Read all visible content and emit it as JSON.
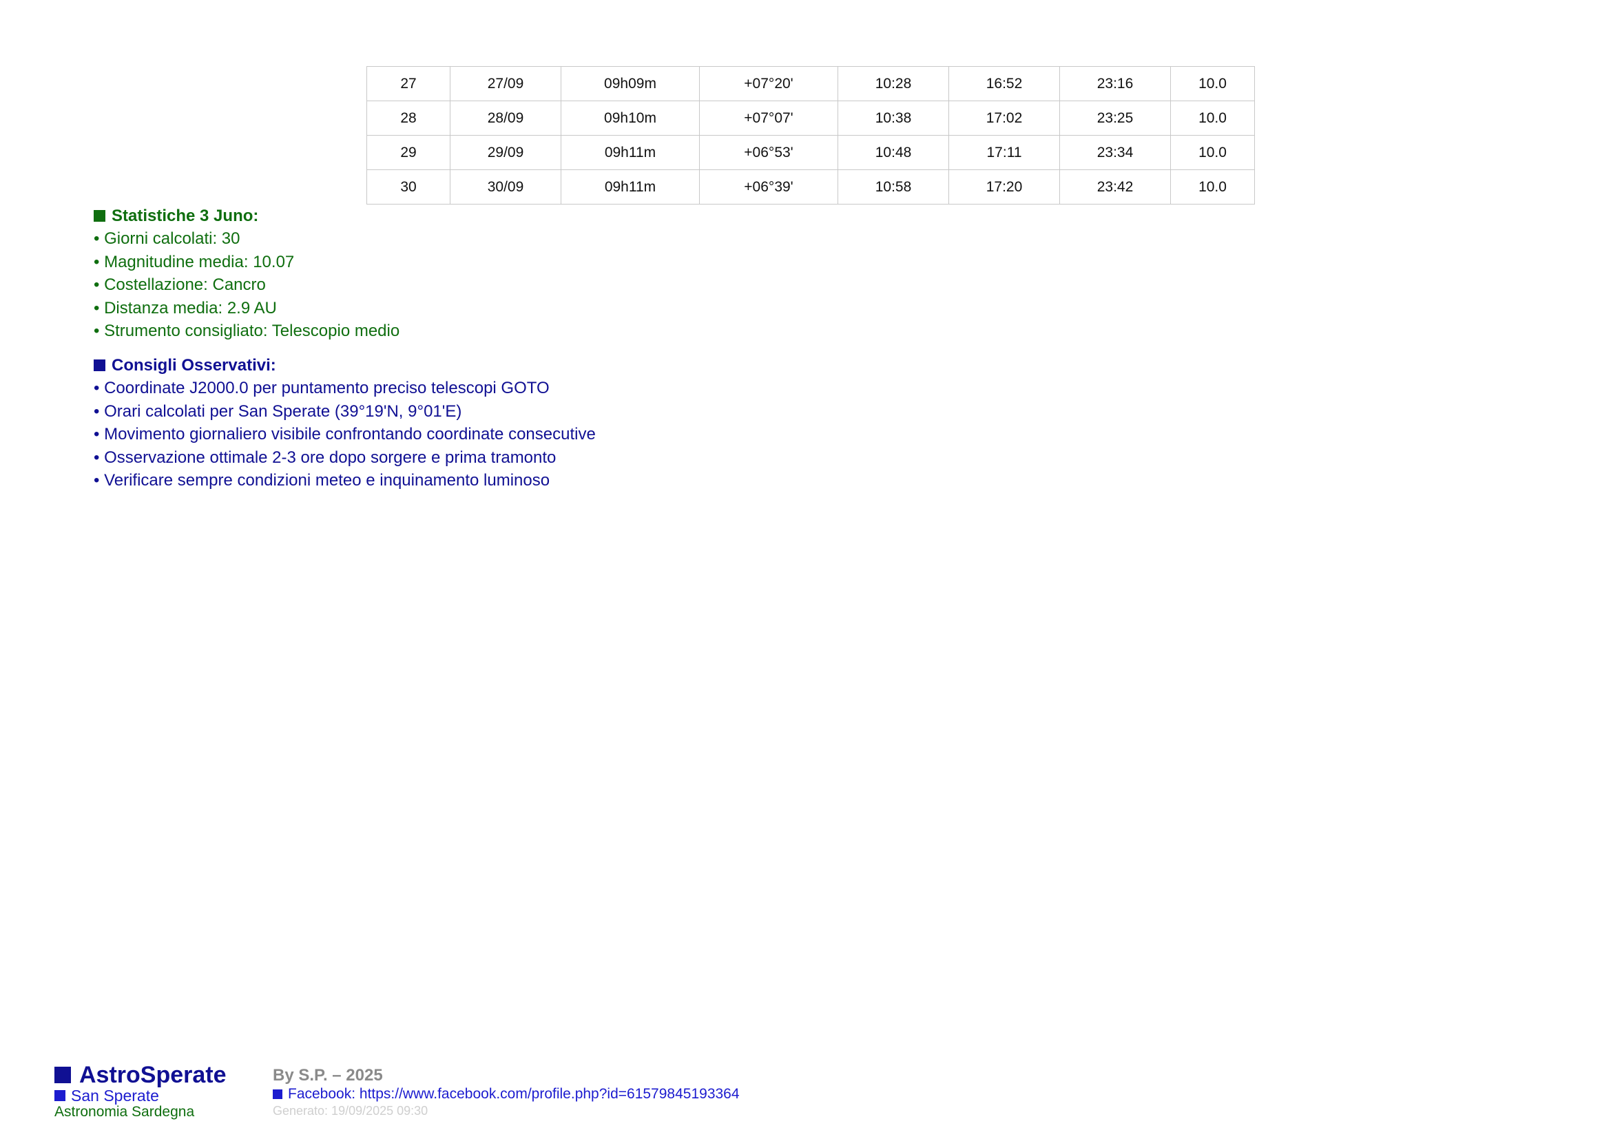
{
  "ephemeris_table": {
    "rows": [
      [
        "27",
        "27/09",
        "09h09m",
        "+07°20'",
        "10:28",
        "16:52",
        "23:16",
        "10.0"
      ],
      [
        "28",
        "28/09",
        "09h10m",
        "+07°07'",
        "10:38",
        "17:02",
        "23:25",
        "10.0"
      ],
      [
        "29",
        "29/09",
        "09h11m",
        "+06°53'",
        "10:48",
        "17:11",
        "23:34",
        "10.0"
      ],
      [
        "30",
        "30/09",
        "09h11m",
        "+06°39'",
        "10:58",
        "17:20",
        "23:42",
        "10.0"
      ]
    ]
  },
  "statistics": {
    "heading": "Statistiche 3 Juno:",
    "items": [
      "• Giorni calcolati: 30",
      "• Magnitudine media: 10.07",
      "• Costellazione: Cancro",
      "• Distanza media: 2.9 AU",
      "• Strumento consigliato: Telescopio medio"
    ]
  },
  "tips": {
    "heading": "Consigli Osservativi:",
    "items": [
      "• Coordinate J2000.0 per puntamento preciso telescopi GOTO",
      "• Orari calcolati per San Sperate (39°19'N, 9°01'E)",
      "• Movimento giornaliero visibile confrontando coordinate consecutive",
      "• Osservazione ottimale 2-3 ore dopo sorgere e prima tramonto",
      "• Verificare sempre condizioni meteo e inquinamento luminoso"
    ]
  },
  "footer": {
    "brand": "AstroSperate",
    "city": "San Sperate",
    "region": "Astronomia Sardegna",
    "author": "By S.P. – 2025",
    "facebook": "Facebook: https://www.facebook.com/profile.php?id=61579845193364",
    "generated": "Generato: 19/09/2025 09:30"
  },
  "colors": {
    "green": "#0f6e0f",
    "navy": "#101093",
    "blue": "#1c1ccf",
    "grey": "#8a8a8a",
    "light_grey": "#cfcfcf"
  }
}
